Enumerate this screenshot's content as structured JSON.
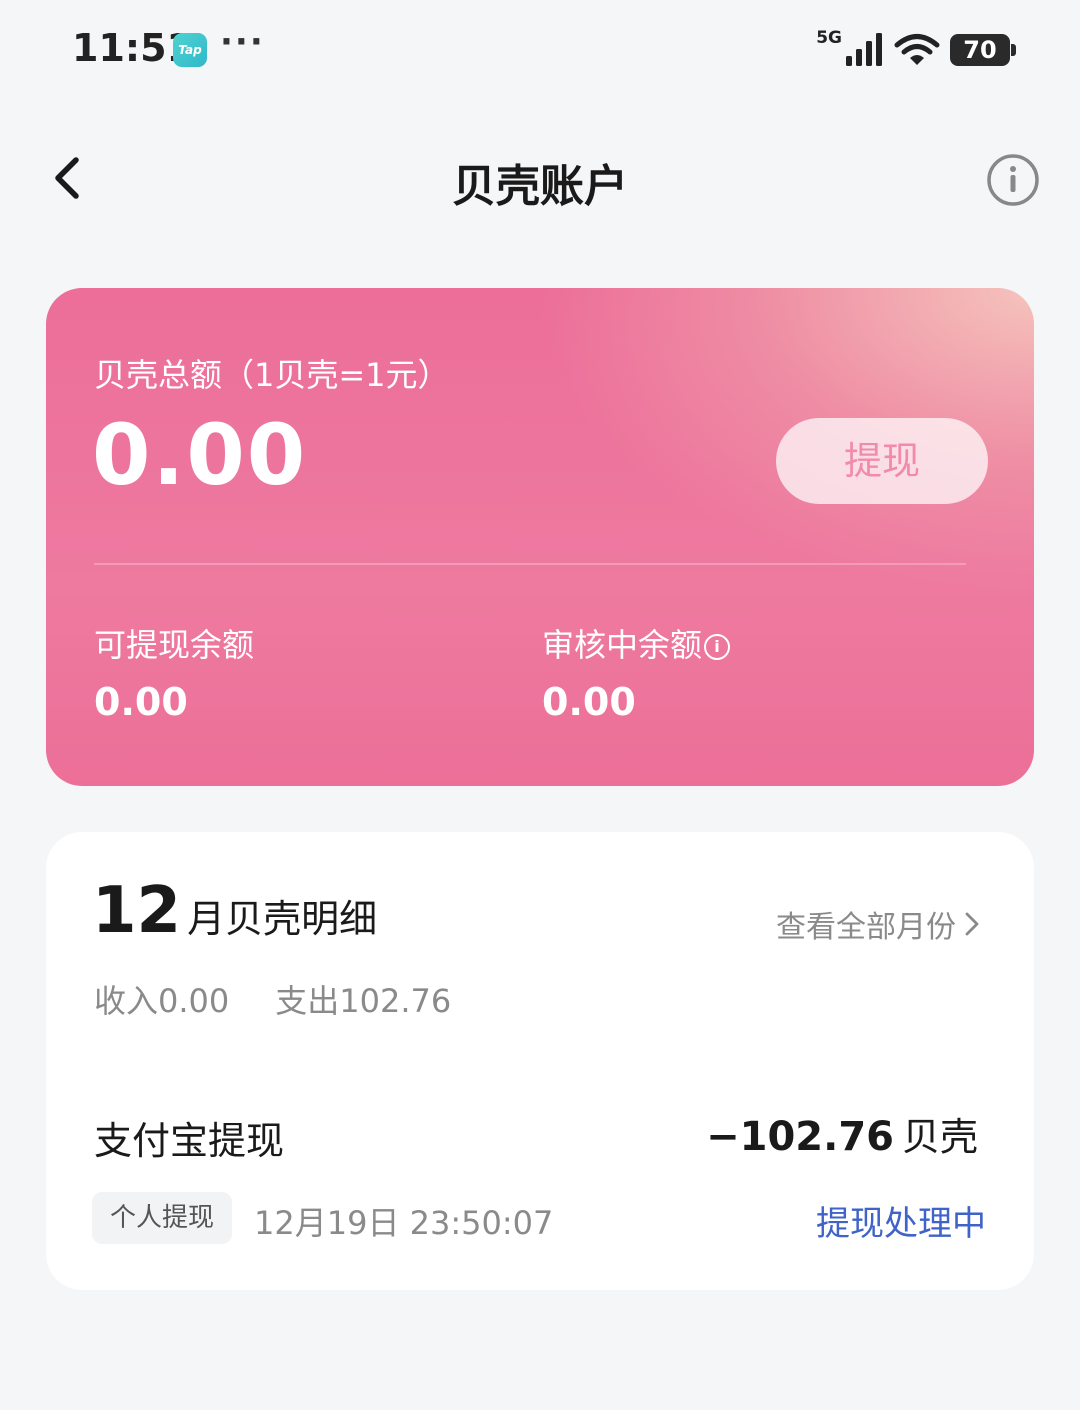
{
  "status_bar": {
    "time": "11:51",
    "app_badge": "Tap",
    "more_dots": "···",
    "network": "5G",
    "battery": "70"
  },
  "nav": {
    "title": "贝壳账户"
  },
  "balance_card": {
    "total_label": "贝壳总额（1贝壳=1元）",
    "total_value": "0.00",
    "withdraw_label": "提现",
    "withdrawable_label": "可提现余额",
    "withdrawable_value": "0.00",
    "reviewing_label": "审核中余额",
    "reviewing_value": "0.00"
  },
  "detail": {
    "month_number": "12",
    "month_suffix": "月贝壳明细",
    "view_all": "查看全部月份",
    "income": "收入0.00",
    "expense": "支出102.76",
    "transactions": [
      {
        "title": "支付宝提现",
        "amount": "−102.76",
        "unit": "贝壳",
        "tag": "个人提现",
        "time": "12月19日 23:50:07",
        "status": "提现处理中"
      }
    ]
  },
  "colors": {
    "accent_pink": "#ec6e99",
    "status_blue": "#3f63c8"
  }
}
